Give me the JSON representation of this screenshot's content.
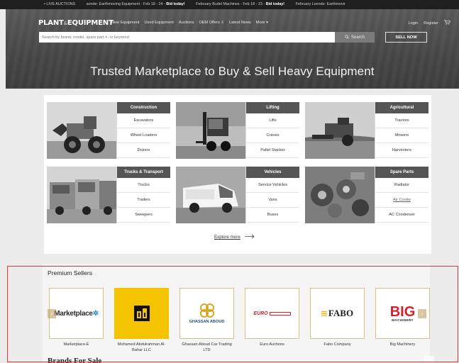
{
  "ticker": {
    "prefix": "• LIVE AUCTIONS",
    "items": [
      {
        "text": "aonde: Earthmoving Equipment - Feb 18 - 24 - ",
        "cta": "Bid today!"
      },
      {
        "text": "February Budel Machines - Feb 18 - 23 - ",
        "cta": "Bid today!"
      },
      {
        "text": "February Leende: Earthmovir",
        "cta": ""
      }
    ]
  },
  "header": {
    "logo_left": "PLANT",
    "logo_mid": "&",
    "logo_right": "EQUIPMENT",
    "nav": [
      "New Equipment",
      "Used Equipment",
      "Auctions",
      "OEM Offers ⇩",
      "Latest News",
      "More ▾"
    ],
    "login": "Login",
    "register": "Register",
    "cart_icon": "cart-icon",
    "search_placeholder": "Search by brand, model, spare part #, or keyword",
    "search_button": "Search",
    "sell_button": "SELL NOW",
    "tagline": "Trusted Marketplace to Buy & Sell Heavy Equipment"
  },
  "categories": [
    {
      "title": "Construction",
      "items": [
        "Excavators",
        "Wheel Loaders",
        "Dozers"
      ]
    },
    {
      "title": "Lifting",
      "items": [
        "Lifts",
        "Cranes",
        "Pallet Stacker"
      ]
    },
    {
      "title": "Agricultural",
      "items": [
        "Tractors",
        "Mowers",
        "Harvesters"
      ]
    },
    {
      "title": "Trucks & Transport",
      "items": [
        "Trucks",
        "Trailers",
        "Sweepers"
      ]
    },
    {
      "title": "Vehicles",
      "items": [
        "Service Vehicles",
        "Vans",
        "Buses"
      ]
    },
    {
      "title": "Spare Parts",
      "items": [
        "Radiator",
        "Air Cooler",
        "AC Condenser"
      ]
    }
  ],
  "explore_label": "Explore more",
  "premium": {
    "title": "Premium Sellers",
    "sellers": [
      {
        "name": "Marketplace-E",
        "logo": "Marketplace"
      },
      {
        "name": "Mohamed Abdulrahman Al-Bahar LLC",
        "logo": ""
      },
      {
        "name": "Ghassan Aboud Car Trading LTD",
        "logo": "GHASSAN ABOUD"
      },
      {
        "name": "Euro Auctions",
        "logo": "EURO"
      },
      {
        "name": "Fabo Company",
        "logo": "FABO"
      },
      {
        "name": "Big Machinery",
        "logo": "BIG"
      }
    ]
  },
  "brands_heading": "Brands For Sale",
  "colors": {
    "accent": "#e33333",
    "gold": "#d9c28a",
    "dark": "#555555"
  }
}
